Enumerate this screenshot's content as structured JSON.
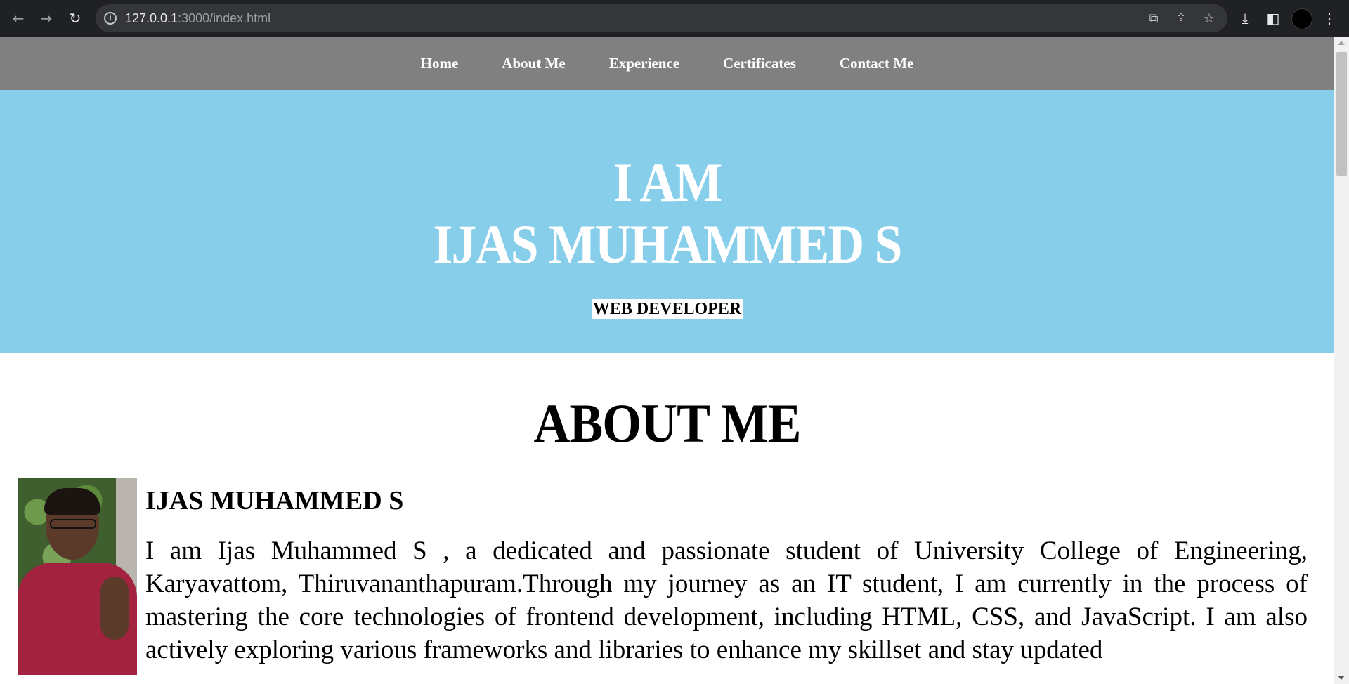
{
  "browser": {
    "url_host": "127.0.0.1",
    "url_rest": ":3000/index.html",
    "icons": {
      "back": "arrow-left-icon",
      "forward": "arrow-right-icon",
      "reload": "reload-icon",
      "site_info": "info-icon",
      "translate": "translate-icon",
      "share": "share-icon",
      "bookmark": "star-icon",
      "download": "download-icon",
      "side_panel": "side-panel-icon",
      "menu": "kebab-menu-icon"
    }
  },
  "site": {
    "nav": [
      "Home",
      "About Me",
      "Experience",
      "Certificates",
      "Contact Me"
    ],
    "hero": {
      "line1": "I AM",
      "line2": "IJAS MUHAMMED S",
      "role": "WEB DEVELOPER"
    },
    "about": {
      "title": "ABOUT ME",
      "name": "IJAS MUHAMMED S",
      "bio": "I am Ijas Muhammed S , a dedicated and passionate student of University College of Engineering, Karyavattom, Thiruvananthapuram.Through my journey as an IT student, I am currently in the process of mastering the core technologies of frontend development, including HTML, CSS, and JavaScript. I am also actively exploring various frameworks and libraries to enhance my skillset and stay updated"
    }
  },
  "colors": {
    "nav_bg": "#808080",
    "hero_bg": "#87ceeb",
    "chrome_bg": "#202124"
  }
}
